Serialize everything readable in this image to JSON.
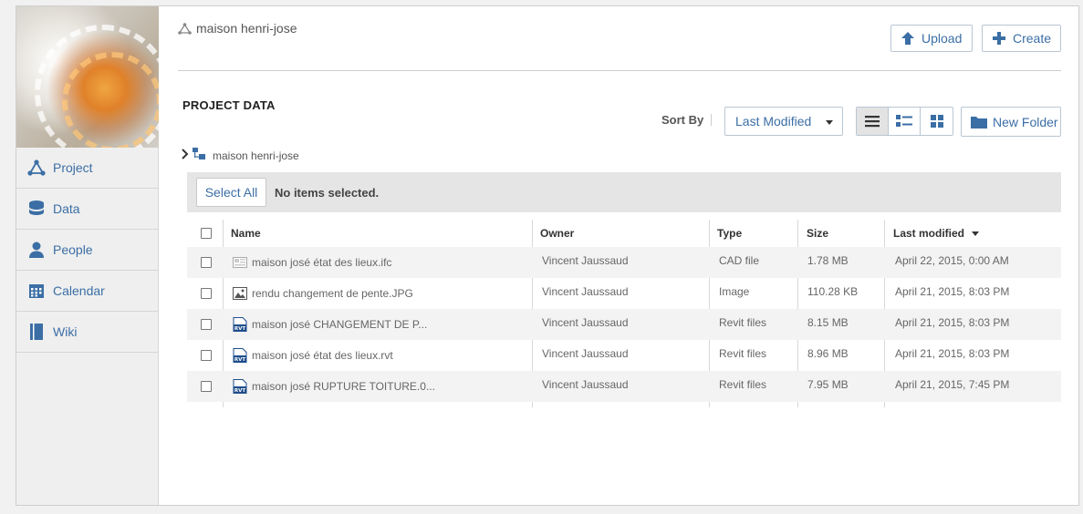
{
  "sidebar": {
    "items": [
      {
        "label": "Project",
        "icon": "project-icon"
      },
      {
        "label": "Data",
        "icon": "database-icon"
      },
      {
        "label": "People",
        "icon": "person-icon"
      },
      {
        "label": "Calendar",
        "icon": "calendar-icon"
      },
      {
        "label": "Wiki",
        "icon": "book-icon"
      }
    ]
  },
  "header": {
    "breadcrumb": "maison henri-jose",
    "upload_label": "Upload",
    "create_label": "Create"
  },
  "section": {
    "title": "PROJECT DATA",
    "sort_by_label": "Sort By",
    "sort_value": "Last Modified",
    "new_folder_label": "New Folder"
  },
  "tree": {
    "root_label": "maison henri-jose"
  },
  "selection": {
    "select_all_label": "Select All",
    "status": "No items selected."
  },
  "table": {
    "columns": {
      "name": "Name",
      "owner": "Owner",
      "type": "Type",
      "size": "Size",
      "modified": "Last modified"
    },
    "rows": [
      {
        "name": "maison josé état des lieux.ifc",
        "owner": "Vincent Jaussaud",
        "type": "CAD file",
        "size": "1.78 MB",
        "modified": "April 22, 2015, 0:00 AM",
        "icon": "cad-file-icon"
      },
      {
        "name": "rendu changement de pente.JPG",
        "owner": "Vincent Jaussaud",
        "type": "Image",
        "size": "110.28 KB",
        "modified": "April 21, 2015, 8:03 PM",
        "icon": "image-file-icon"
      },
      {
        "name": "maison josé CHANGEMENT DE P...",
        "owner": "Vincent Jaussaud",
        "type": "Revit files",
        "size": "8.15 MB",
        "modified": "April 21, 2015, 8:03 PM",
        "icon": "revit-file-icon"
      },
      {
        "name": "maison josé état des lieux.rvt",
        "owner": "Vincent Jaussaud",
        "type": "Revit files",
        "size": "8.96 MB",
        "modified": "April 21, 2015, 8:03 PM",
        "icon": "revit-file-icon"
      },
      {
        "name": "maison josé RUPTURE TOITURE.0...",
        "owner": "Vincent Jaussaud",
        "type": "Revit files",
        "size": "7.95 MB",
        "modified": "April 21, 2015, 7:45 PM",
        "icon": "revit-file-icon"
      }
    ]
  },
  "colors": {
    "accent": "#3b6ea5",
    "sidebar_bg": "#efefef",
    "toolbar_bg": "#e5e5e5"
  }
}
